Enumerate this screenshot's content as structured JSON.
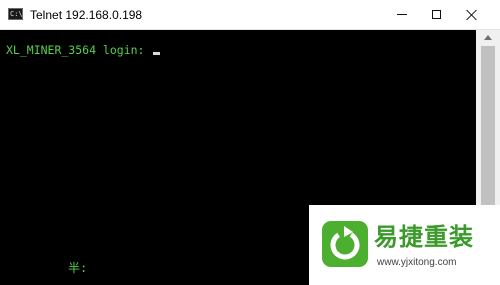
{
  "window": {
    "title": "Telnet 192.168.0.198",
    "icon_label": "C:\\"
  },
  "titlebar_buttons": {
    "minimize_icon": "minimize-icon",
    "maximize_icon": "maximize-icon",
    "close_icon": "close-icon"
  },
  "console": {
    "prompt": "XL_MINER_3564 login: ",
    "ime_status": "半:"
  },
  "watermark": {
    "title": "易捷重装",
    "url": "www.yjxitong.com"
  },
  "colors": {
    "console_text": "#56d04b",
    "console_bg": "#000000",
    "logo_green": "#4caf2f"
  }
}
